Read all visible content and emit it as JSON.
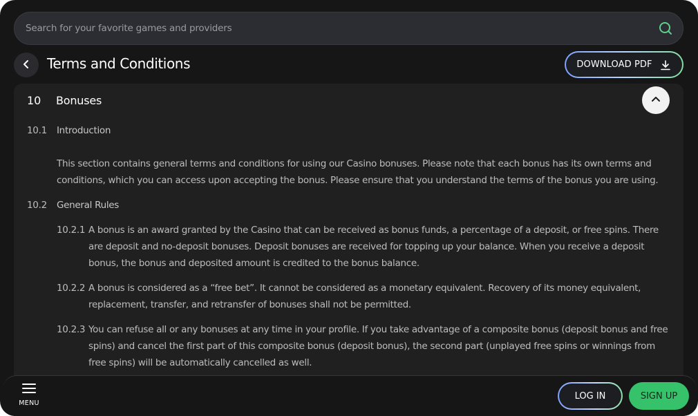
{
  "search": {
    "placeholder": "Search for your favorite games and providers"
  },
  "header": {
    "title": "Terms and Conditions",
    "download_label": "DOWNLOAD PDF"
  },
  "section": {
    "number": "10",
    "title": "Bonuses",
    "items": [
      {
        "number": "10.1",
        "title": "Introduction",
        "lines": [
          "This section contains general terms and conditions for using our Casino bonuses. Please note that each bonus has its own terms and",
          "conditions, which you can access upon accepting the bonus. Please ensure that you understand the terms of the bonus you are using."
        ]
      },
      {
        "number": "10.2",
        "title": "General Rules",
        "subitems": [
          {
            "number": "10.2.1",
            "lines": [
              "A bonus is an award granted by the Casino that can be received as bonus funds, a percentage of a deposit, or free spins. There",
              "are deposit and no-deposit bonuses. Deposit bonuses are received for topping up your balance. When you receive a deposit",
              "bonus, the bonus and deposited amount is credited to the bonus balance."
            ]
          },
          {
            "number": "10.2.2",
            "lines": [
              "A bonus is considered as a “free bet”. It cannot be considered as a monetary equivalent. Recovery of its money equivalent,",
              "replacement, transfer, and retransfer of bonuses shall not be permitted."
            ]
          },
          {
            "number": "10.2.3",
            "lines": [
              "You can refuse all or any bonuses at any time in your profile. If you take advantage of a composite bonus (deposit bonus and free",
              "spins) and cancel the first part of this composite bonus (deposit bonus), the second part (unplayed free spins or winnings from",
              "free spins) will be automatically cancelled as well."
            ]
          }
        ]
      }
    ]
  },
  "bottom_nav": {
    "menu_label": "MENU",
    "login_label": "LOG IN",
    "signup_label": "SIGN UP"
  },
  "icons": {
    "search": "search-icon",
    "back": "chevron-left-icon",
    "download": "download-icon",
    "collapse": "chevron-up-icon",
    "menu": "hamburger-icon"
  },
  "colors": {
    "background": "#161616",
    "panel": "#202020",
    "accent_green": "#36c26a",
    "search_icon": "#5ed08a"
  }
}
